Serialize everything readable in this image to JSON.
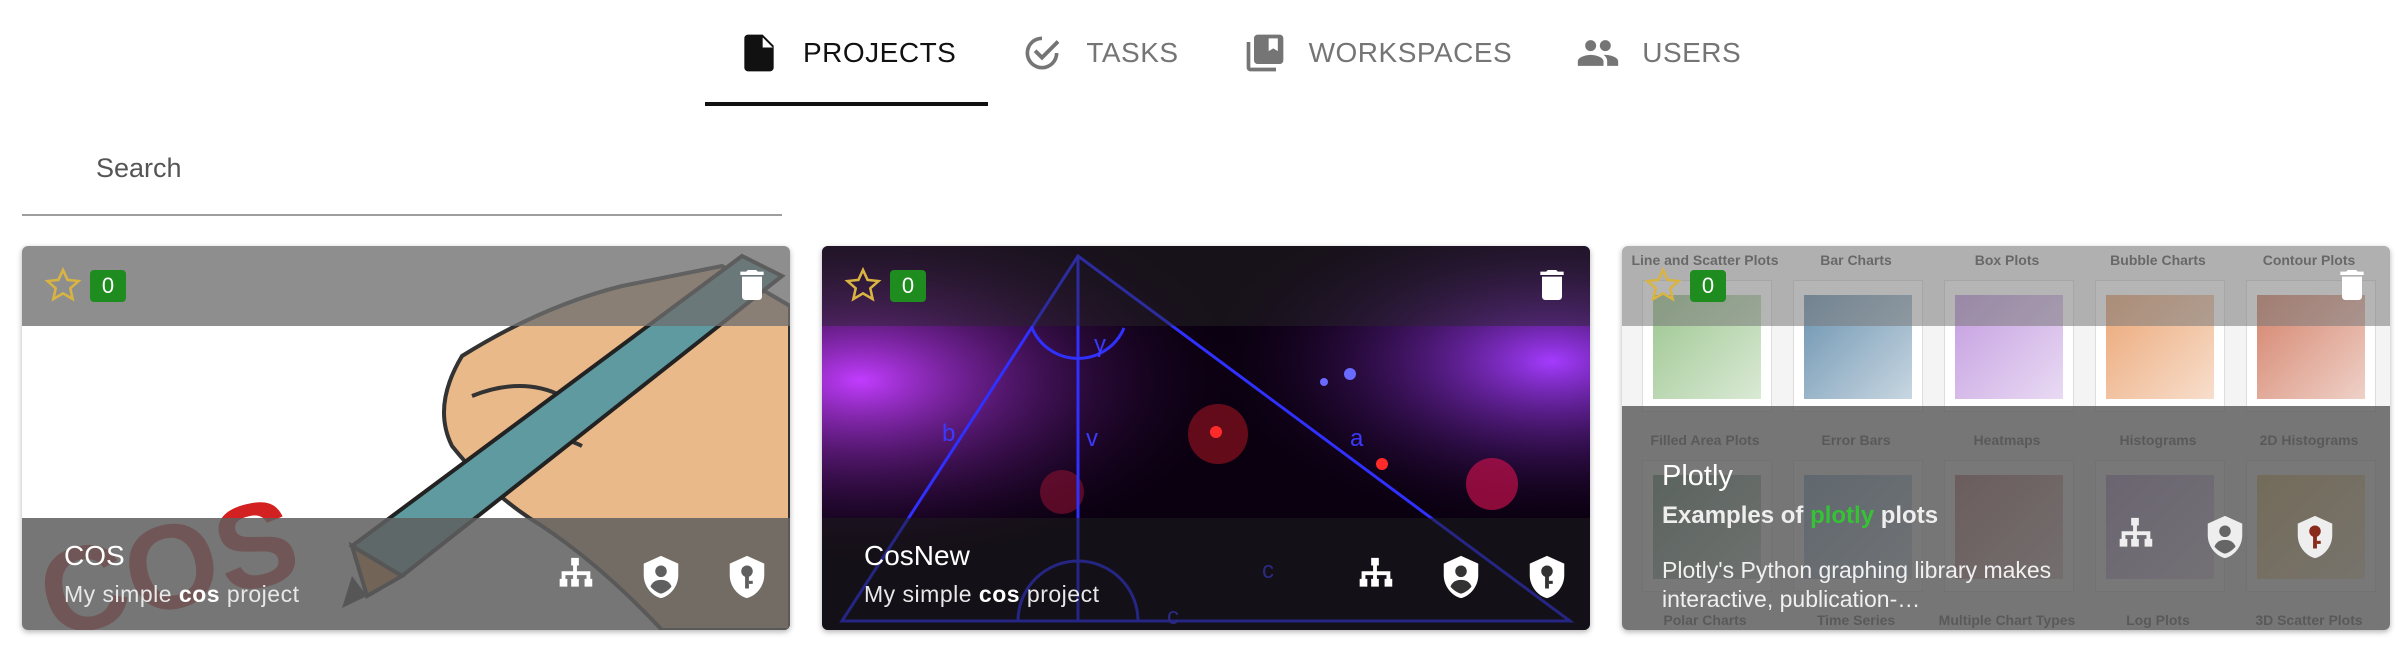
{
  "tabs": [
    {
      "label": "PROJECTS",
      "icon": "document-icon",
      "active": true
    },
    {
      "label": "TASKS",
      "icon": "check-circle-icon",
      "active": false
    },
    {
      "label": "WORKSPACES",
      "icon": "library-books-icon",
      "active": false
    },
    {
      "label": "USERS",
      "icon": "people-icon",
      "active": false
    }
  ],
  "search": {
    "placeholder": "Search",
    "value": ""
  },
  "projects": [
    {
      "title": "COS",
      "desc_prefix": "My simple ",
      "desc_bold": "cos",
      "desc_suffix": " project",
      "favorites": "0"
    },
    {
      "title": "CosNew",
      "desc_prefix": "My simple ",
      "desc_bold": "cos",
      "desc_suffix": " project",
      "favorites": "0"
    },
    {
      "title": "Plotly",
      "subtitle_prefix": "Examples of ",
      "subtitle_highlight": "plotly",
      "subtitle_suffix": " plots",
      "description": "Plotly's Python graphing library makes interactive, publication-…",
      "favorites": "0",
      "thumbnails": [
        "Line and Scatter Plots",
        "Bar Charts",
        "Box Plots",
        "Bubble Charts",
        "Contour Plots",
        "Filled Area Plots",
        "Error Bars",
        "Heatmaps",
        "Histograms",
        "2D Histograms",
        "Polar Charts",
        "Time Series",
        "Multiple Chart Types",
        "Log Plots",
        "3D Scatter Plots"
      ]
    }
  ],
  "colors": {
    "accent": "#111111",
    "badge": "#1e8c1e",
    "highlight": "#35c235",
    "muted": "#757575"
  }
}
